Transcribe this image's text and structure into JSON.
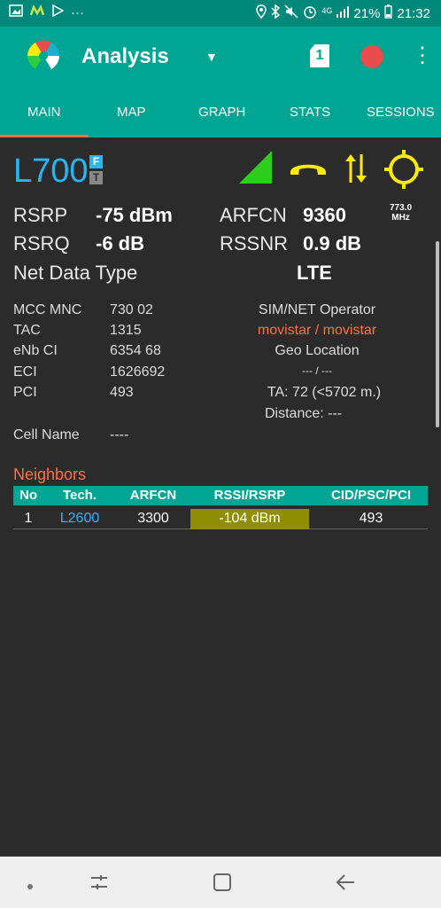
{
  "status_bar": {
    "time": "21:32",
    "battery": "21%",
    "network_type": "4G",
    "overflow_dots": "···"
  },
  "app_bar": {
    "title": "Analysis",
    "sim_slot": "1"
  },
  "tabs": [
    {
      "label": "MAIN",
      "active": true
    },
    {
      "label": "MAP",
      "active": false
    },
    {
      "label": "GRAPH",
      "active": false
    },
    {
      "label": "STATS",
      "active": false
    },
    {
      "label": "SESSIONS",
      "active": false
    }
  ],
  "cell": {
    "tech": "L700",
    "badge_f": "F",
    "badge_t": "T",
    "rsrp_label": "RSRP",
    "rsrp_value": "-75 dBm",
    "rsrq_label": "RSRQ",
    "rsrq_value": "-6 dB",
    "arfcn_label": "ARFCN",
    "arfcn_value": "9360",
    "freq_value": "773.0",
    "freq_unit": "MHz",
    "rssnr_label": "RSSNR",
    "rssnr_value": "0.9 dB",
    "net_data_type_label": "Net Data Type",
    "net_data_type_value": "LTE"
  },
  "details": {
    "mcc_mnc_label": "MCC MNC",
    "mcc_mnc_value": "730 02",
    "tac_label": "TAC",
    "tac_value": "1315",
    "enb_ci_label": "eNb CI",
    "enb_ci_value": "6354 68",
    "eci_label": "ECI",
    "eci_value": "1626692",
    "pci_label": "PCI",
    "pci_value": "493",
    "cell_name_label": "Cell Name",
    "cell_name_value": "----",
    "operator_label": "SIM/NET Operator",
    "operator_value": "movistar / movistar",
    "geo_label": "Geo Location",
    "geo_value": "--- / ---",
    "ta_value": "TA: 72 (<5702 m.)",
    "distance_value": "Distance: ---"
  },
  "neighbors": {
    "title": "Neighbors",
    "headers": [
      "No",
      "Tech.",
      "ARFCN",
      "RSSI/RSRP",
      "CID/PSC/PCI"
    ],
    "rows": [
      {
        "no": "1",
        "tech": "L2600",
        "arfcn": "3300",
        "rssi": "-104 dBm",
        "cid": "493"
      }
    ]
  },
  "colors": {
    "teal": "#00a693",
    "tech_blue": "#29b6f6",
    "accent_orange": "#ff7043",
    "signal_green": "#2ecc1f",
    "yellow": "#ffeb00",
    "rssi_cell": "#8f8d00"
  }
}
